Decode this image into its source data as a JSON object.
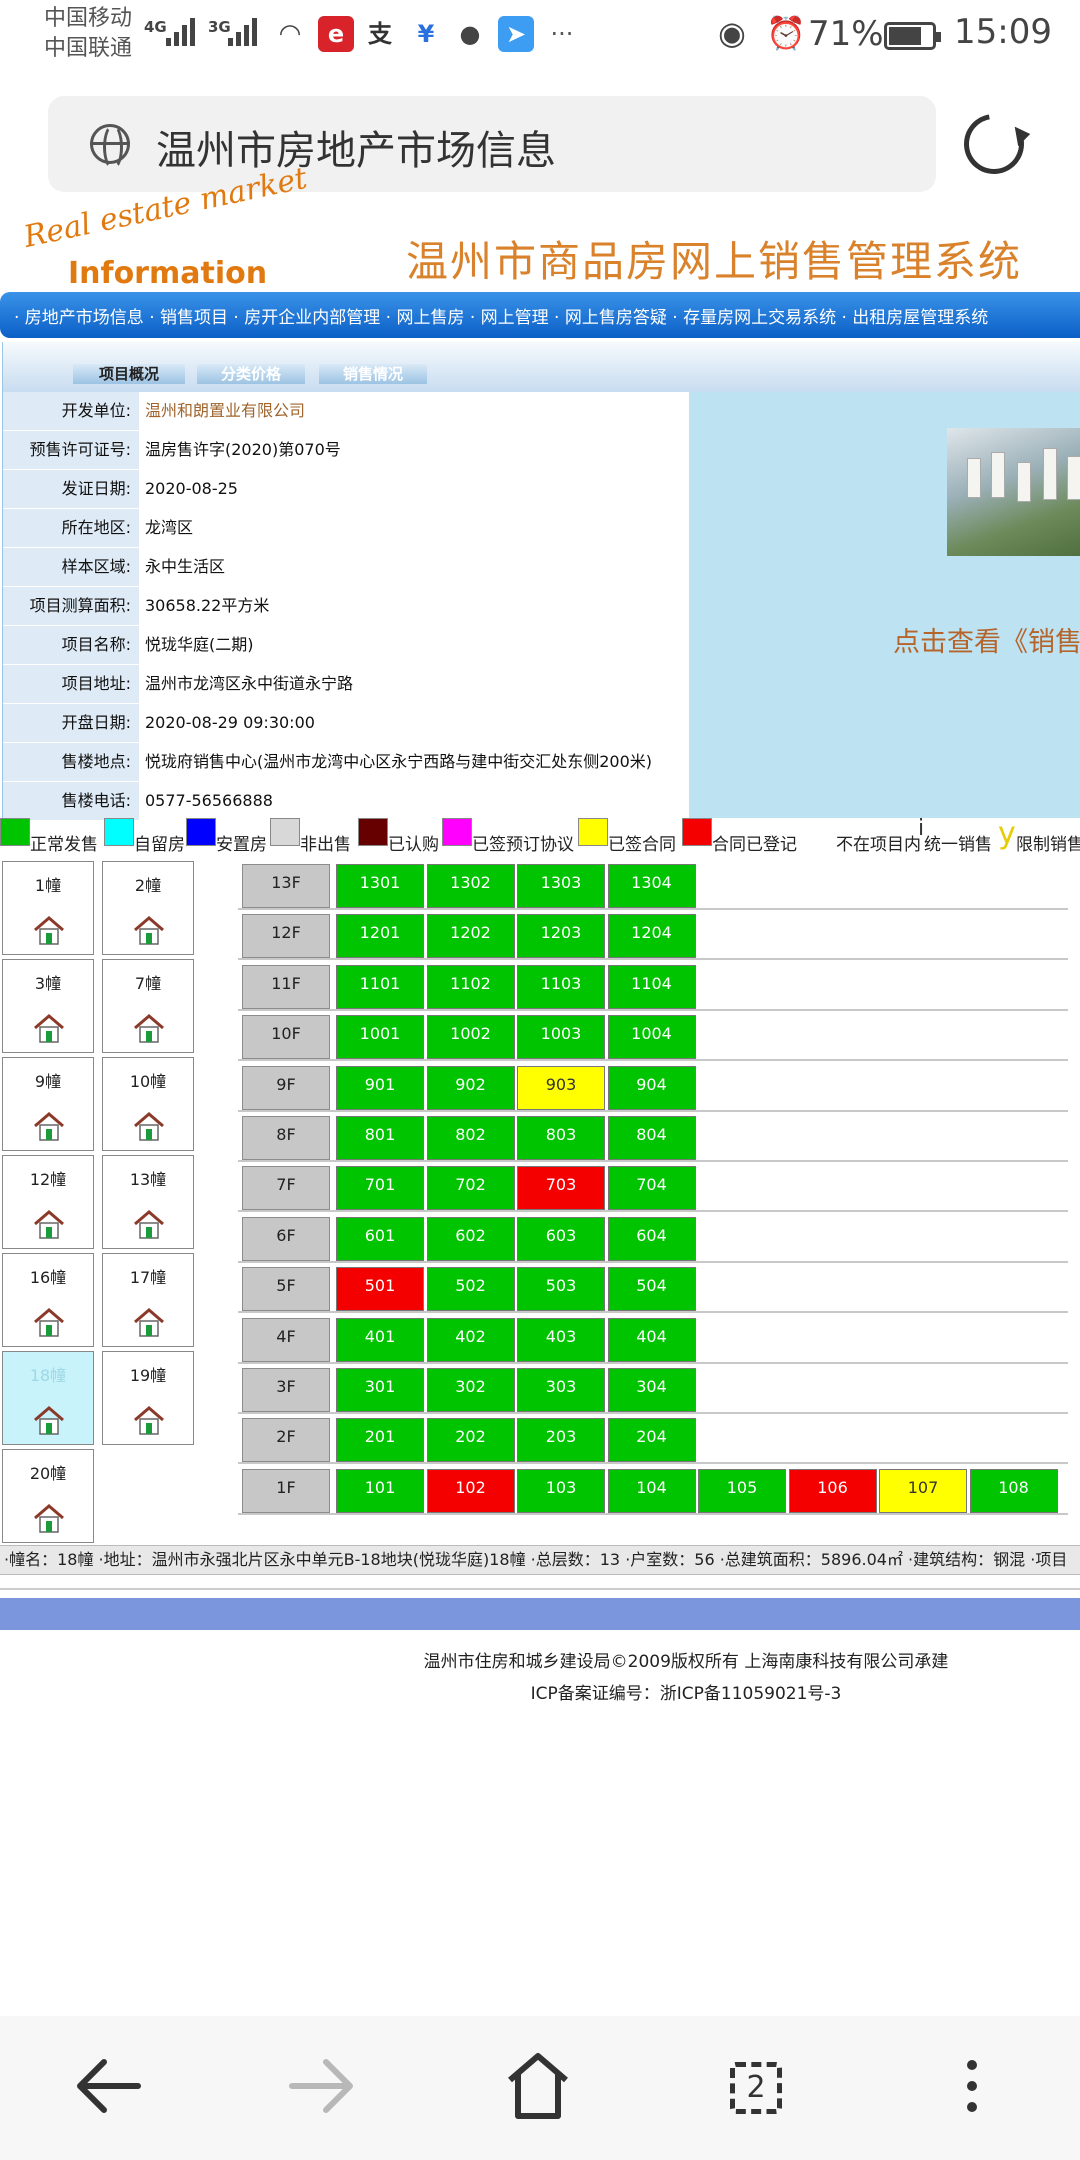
{
  "status_bar": {
    "carrier1": "中国移动",
    "carrier2": "中国联通",
    "net1": "4G",
    "net2": "3G",
    "more": "···",
    "battery": "71%",
    "time": "15:09"
  },
  "browser": {
    "page_title": "温州市房地产市场信息"
  },
  "site": {
    "logo_line1": "Real estate market",
    "logo_line2": "Information",
    "title": "温州市商品房网上销售管理系统",
    "nav": "· 房地产市场信息 · 销售项目 · 房开企业内部管理 · 网上售房 · 网上管理 · 网上售房答疑 · 存量房网上交易系统 · 出租房屋管理系统"
  },
  "tabs": [
    "项目概况",
    "分类价格",
    "销售情况"
  ],
  "project_info": [
    {
      "label": "开发单位:",
      "value": "温州和朗置业有限公司"
    },
    {
      "label": "预售许可证号:",
      "value": "温房售许字(2020)第070号"
    },
    {
      "label": "发证日期:",
      "value": "2020-08-25"
    },
    {
      "label": "所在地区:",
      "value": "龙湾区"
    },
    {
      "label": "样本区域:",
      "value": "永中生活区"
    },
    {
      "label": "项目测算面积:",
      "value": "30658.22平方米"
    },
    {
      "label": "项目名称:",
      "value": "悦珑华庭(二期)"
    },
    {
      "label": "项目地址:",
      "value": "温州市龙湾区永中街道永宁路"
    },
    {
      "label": "开盘日期:",
      "value": "2020-08-29 09:30:00"
    },
    {
      "label": "售楼地点:",
      "value": "悦珑府销售中心(温州市龙湾中心区永宁西路与建中街交汇处东侧200米)"
    },
    {
      "label": "售楼电话:",
      "value": "0577-56566888"
    }
  ],
  "click_text": "点击查看《销售",
  "legend": [
    {
      "label": "正常发售",
      "color": "#00c400"
    },
    {
      "label": "自留房",
      "color": "#00ffff"
    },
    {
      "label": "安置房",
      "color": "#0000ff"
    },
    {
      "label": "非出售",
      "color": "#d8d8d8"
    },
    {
      "label": "已认购",
      "color": "#660000"
    },
    {
      "label": "已签预订协议",
      "color": "#ff00ff"
    },
    {
      "label": "已签合同",
      "color": "#ffff00"
    },
    {
      "label": "合同已登记",
      "color": "#f40000"
    },
    {
      "label": "不在项目内",
      "color": "#ffffff"
    },
    {
      "label": "统一销售",
      "mark": "i"
    },
    {
      "label": "限制销售",
      "mark": "y"
    }
  ],
  "buildings": [
    "1幢",
    "2幢",
    "3幢",
    "7幢",
    "9幢",
    "10幢",
    "12幢",
    "13幢",
    "16幢",
    "17幢",
    "18幢",
    "19幢",
    "20幢"
  ],
  "active_building": "18幢",
  "floors": [
    {
      "floor": "13F",
      "units": [
        [
          "1301",
          "green"
        ],
        [
          "1302",
          "green"
        ],
        [
          "1303",
          "green"
        ],
        [
          "1304",
          "green"
        ]
      ]
    },
    {
      "floor": "12F",
      "units": [
        [
          "1201",
          "green"
        ],
        [
          "1202",
          "green"
        ],
        [
          "1203",
          "green"
        ],
        [
          "1204",
          "green"
        ]
      ]
    },
    {
      "floor": "11F",
      "units": [
        [
          "1101",
          "green"
        ],
        [
          "1102",
          "green"
        ],
        [
          "1103",
          "green"
        ],
        [
          "1104",
          "green"
        ]
      ]
    },
    {
      "floor": "10F",
      "units": [
        [
          "1001",
          "green"
        ],
        [
          "1002",
          "green"
        ],
        [
          "1003",
          "green"
        ],
        [
          "1004",
          "green"
        ]
      ]
    },
    {
      "floor": "9F",
      "units": [
        [
          "901",
          "green"
        ],
        [
          "902",
          "green"
        ],
        [
          "903",
          "yellow"
        ],
        [
          "904",
          "green"
        ]
      ]
    },
    {
      "floor": "8F",
      "units": [
        [
          "801",
          "green"
        ],
        [
          "802",
          "green"
        ],
        [
          "803",
          "green"
        ],
        [
          "804",
          "green"
        ]
      ]
    },
    {
      "floor": "7F",
      "units": [
        [
          "701",
          "green"
        ],
        [
          "702",
          "green"
        ],
        [
          "703",
          "red"
        ],
        [
          "704",
          "green"
        ]
      ]
    },
    {
      "floor": "6F",
      "units": [
        [
          "601",
          "green"
        ],
        [
          "602",
          "green"
        ],
        [
          "603",
          "green"
        ],
        [
          "604",
          "green"
        ]
      ]
    },
    {
      "floor": "5F",
      "units": [
        [
          "501",
          "red"
        ],
        [
          "502",
          "green"
        ],
        [
          "503",
          "green"
        ],
        [
          "504",
          "green"
        ]
      ]
    },
    {
      "floor": "4F",
      "units": [
        [
          "401",
          "green"
        ],
        [
          "402",
          "green"
        ],
        [
          "403",
          "green"
        ],
        [
          "404",
          "green"
        ]
      ]
    },
    {
      "floor": "3F",
      "units": [
        [
          "301",
          "green"
        ],
        [
          "302",
          "green"
        ],
        [
          "303",
          "green"
        ],
        [
          "304",
          "green"
        ]
      ]
    },
    {
      "floor": "2F",
      "units": [
        [
          "201",
          "green"
        ],
        [
          "202",
          "green"
        ],
        [
          "203",
          "green"
        ],
        [
          "204",
          "green"
        ]
      ]
    },
    {
      "floor": "1F",
      "units": [
        [
          "101",
          "green"
        ],
        [
          "102",
          "red"
        ],
        [
          "103",
          "green"
        ],
        [
          "104",
          "green"
        ],
        [
          "105",
          "green"
        ],
        [
          "106",
          "red"
        ],
        [
          "107",
          "yellow"
        ],
        [
          "108",
          "green"
        ]
      ]
    }
  ],
  "building_info": "·幢名：18幢 ·地址：温州市永强北片区永中单元B-18地块(悦珑华庭)18幢 ·总层数：13 ·户室数：56 ·总建筑面积：5896.04㎡ ·建筑结构：钢混 ·项目",
  "footer": {
    "copyright": "温州市住房和城乡建设局©2009版权所有  上海南康科技有限公司承建",
    "icp": "ICP备案证编号：浙ICP备11059021号-3"
  },
  "bottom_nav": {
    "tab_count": "2"
  }
}
